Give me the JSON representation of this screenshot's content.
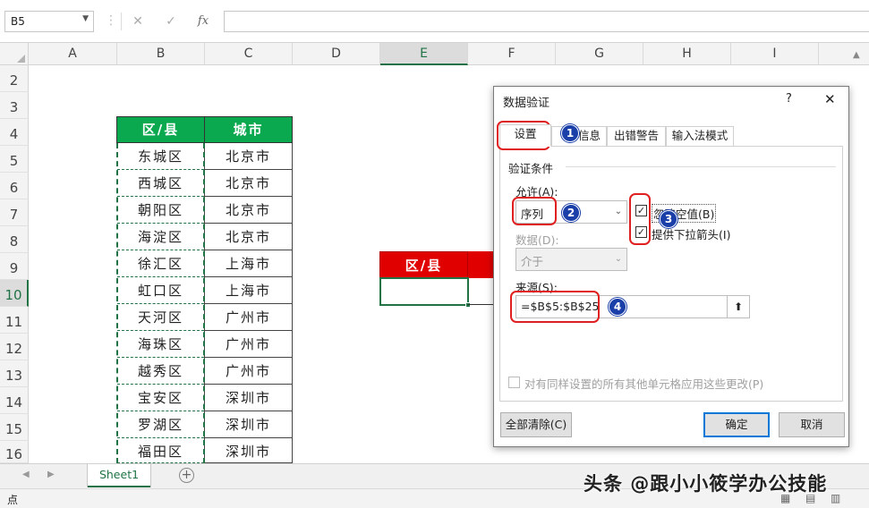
{
  "formula_bar": {
    "name_box": "B5",
    "cancel_icon": "✕",
    "enter_icon": "✓",
    "fx_label": "fx"
  },
  "columns": [
    "A",
    "B",
    "C",
    "D",
    "E",
    "F",
    "G",
    "H",
    "I"
  ],
  "rows": [
    "2",
    "3",
    "4",
    "5",
    "6",
    "7",
    "8",
    "9",
    "10",
    "11",
    "12",
    "13",
    "14",
    "15",
    "16"
  ],
  "table": {
    "headers": [
      "区/县",
      "城市"
    ],
    "rows": [
      [
        "东城区",
        "北京市"
      ],
      [
        "西城区",
        "北京市"
      ],
      [
        "朝阳区",
        "北京市"
      ],
      [
        "海淀区",
        "北京市"
      ],
      [
        "徐汇区",
        "上海市"
      ],
      [
        "虹口区",
        "上海市"
      ],
      [
        "天河区",
        "广州市"
      ],
      [
        "海珠区",
        "广州市"
      ],
      [
        "越秀区",
        "广州市"
      ],
      [
        "宝安区",
        "深圳市"
      ],
      [
        "罗湖区",
        "深圳市"
      ],
      [
        "福田区",
        "深圳市"
      ]
    ]
  },
  "target_header": "区/县",
  "dialog": {
    "title": "数据验证",
    "help": "?",
    "close": "✕",
    "tabs": [
      "设置",
      "输入信息",
      "出错警告",
      "输入法模式"
    ],
    "tab_info_visible": "信息",
    "group_label": "验证条件",
    "allow_label": "允许(A):",
    "allow_value": "序列",
    "data_label": "数据(D):",
    "data_value": "介于",
    "ignore_blank": "忽略空值(B)",
    "dropdown_arrow": "提供下拉箭头(I)",
    "source_label": "来源(S):",
    "source_value": "=$B$5:$B$25",
    "apply_all": "对有同样设置的所有其他单元格应用这些更改(P)",
    "clear_all": "全部清除(C)",
    "ok": "确定",
    "cancel": "取消"
  },
  "badges": [
    "1",
    "2",
    "3",
    "4"
  ],
  "sheet_tab": "Sheet1",
  "status_text": "点",
  "watermark": "头条 @跟小小筱学办公技能",
  "colors": {
    "header_green": "#0aa84f",
    "header_red": "#e00000",
    "excel_green": "#217346",
    "badge_blue": "#1a3fa8",
    "highlight_red": "#e02020"
  }
}
